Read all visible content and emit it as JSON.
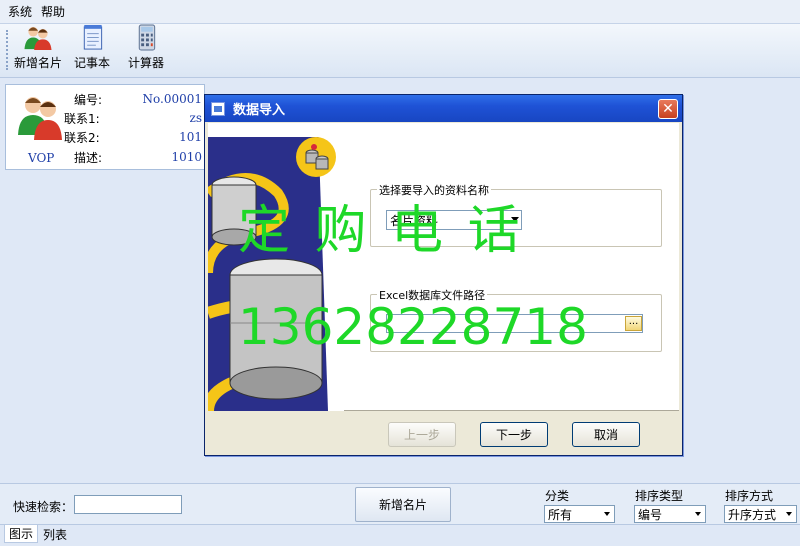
{
  "menu": {
    "items": [
      "系统",
      "帮助"
    ]
  },
  "toolbar": {
    "buttons": [
      {
        "label": "新增名片",
        "icon": "users-icon"
      },
      {
        "label": "记事本",
        "icon": "notepad-icon"
      },
      {
        "label": "计算器",
        "icon": "calculator-icon"
      }
    ]
  },
  "card": {
    "fields": [
      {
        "key": "编号:",
        "value": "No.00001"
      },
      {
        "key": "联系1:",
        "value": "zs"
      },
      {
        "key": "联系2:",
        "value": "101"
      },
      {
        "key": "描述:",
        "value": "1010"
      }
    ],
    "tag": "VOP",
    "icon": "users-icon"
  },
  "dialog": {
    "title": "数据导入",
    "group1": {
      "legend": "选择要导入的资料名称",
      "selected": "名片资料"
    },
    "group2": {
      "legend": "Excel数据库文件路径",
      "path": "",
      "browse_label": "..."
    },
    "buttons": {
      "prev": "上一步",
      "next": "下一步",
      "cancel": "取消"
    }
  },
  "watermark": {
    "line1": "定 购 电 话",
    "line2": "13628228718"
  },
  "bottom": {
    "search_label": "快速检索：",
    "search_value": "",
    "add_button": "新增名片",
    "filters": [
      {
        "label": "分类",
        "value": "所有"
      },
      {
        "label": "排序类型",
        "value": "编号"
      },
      {
        "label": "排序方式",
        "value": "升序方式"
      }
    ]
  },
  "tabs": [
    "图示",
    "列表"
  ],
  "colors": {
    "watermark": "#1ed828",
    "titlebar": "#1f52d6",
    "link_blue": "#1f3fa8"
  }
}
